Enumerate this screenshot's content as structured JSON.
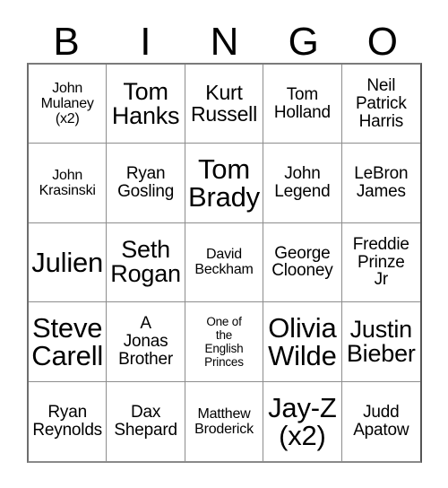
{
  "header": {
    "letters": [
      "B",
      "I",
      "N",
      "G",
      "O"
    ]
  },
  "grid": {
    "rows": 5,
    "columns": 5,
    "cells": [
      {
        "text": "John\nMulaney\n(x2)",
        "size": "sm"
      },
      {
        "text": "Tom\nHanks",
        "size": "xl"
      },
      {
        "text": "Kurt\nRussell",
        "size": "lg"
      },
      {
        "text": "Tom\nHolland",
        "size": "md"
      },
      {
        "text": "Neil\nPatrick\nHarris",
        "size": "md"
      },
      {
        "text": "John\nKrasinski",
        "size": "sm"
      },
      {
        "text": "Ryan\nGosling",
        "size": "md"
      },
      {
        "text": "Tom\nBrady",
        "size": "xxl"
      },
      {
        "text": "John\nLegend",
        "size": "md"
      },
      {
        "text": "LeBron\nJames",
        "size": "md"
      },
      {
        "text": "Julien",
        "size": "xxl"
      },
      {
        "text": "Seth\nRogan",
        "size": "xl"
      },
      {
        "text": "David\nBeckham",
        "size": "sm"
      },
      {
        "text": "George\nClooney",
        "size": "md"
      },
      {
        "text": "Freddie\nPrinze\nJr",
        "size": "md"
      },
      {
        "text": "Steve\nCarell",
        "size": "xxl"
      },
      {
        "text": "A\nJonas\nBrother",
        "size": "md"
      },
      {
        "text": "One of\nthe\nEnglish\nPrinces",
        "size": "xs"
      },
      {
        "text": "Olivia\nWilde",
        "size": "xxl"
      },
      {
        "text": "Justin\nBieber",
        "size": "xl"
      },
      {
        "text": "Ryan\nReynolds",
        "size": "md"
      },
      {
        "text": "Dax\nShepard",
        "size": "md"
      },
      {
        "text": "Matthew\nBroderick",
        "size": "sm"
      },
      {
        "text": "Jay-Z\n(x2)",
        "size": "xxl"
      },
      {
        "text": "Judd\nApatow",
        "size": "md"
      }
    ]
  },
  "colors": {
    "background": "#ffffff",
    "text": "#000000",
    "grid_line": "#8d8d8d",
    "grid_border": "#6e6e6e"
  }
}
